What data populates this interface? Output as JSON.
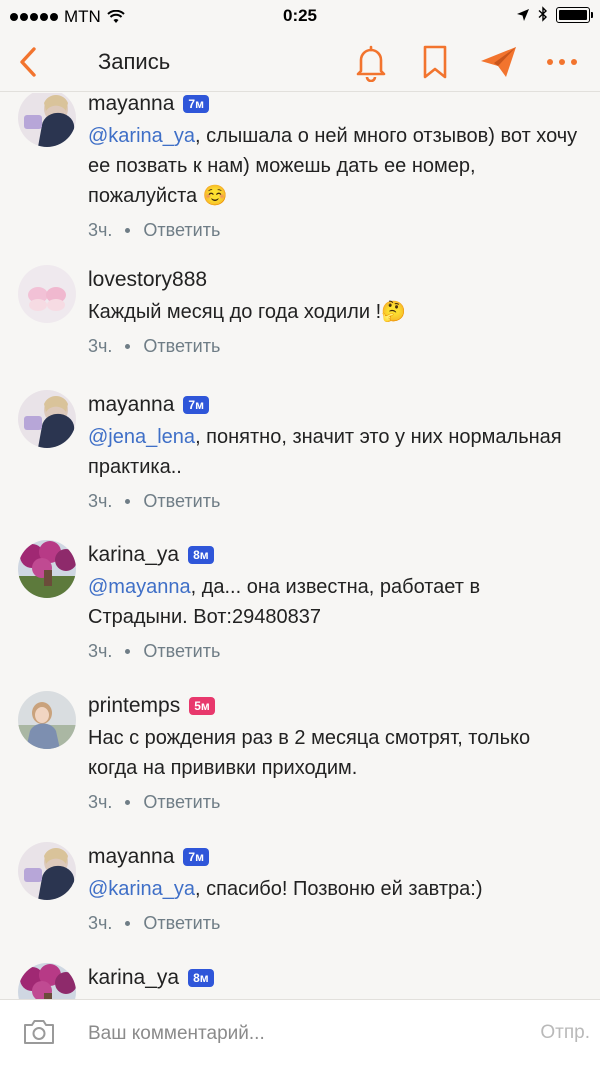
{
  "status_bar": {
    "carrier": "MTN",
    "time": "0:25"
  },
  "nav": {
    "title": "Запись",
    "icons": [
      "back-icon",
      "bell-icon",
      "bookmark-icon",
      "send-icon",
      "more-icon"
    ],
    "accent_color": "#f2742e"
  },
  "comments": [
    {
      "username": "mayanna",
      "badge": "7м",
      "badge_color": "#2f56d9",
      "mention": "@karina_ya",
      "text": ", слышала о ней много отзывов) вот хочу ее позвать к нам) можешь дать ее номер, пожалуйста ☺️",
      "time": "3ч.",
      "reply_label": "Ответить"
    },
    {
      "username": "lovestory888",
      "badge": "",
      "mention": "",
      "text": "Каждый месяц до года ходили !🤔",
      "time": "3ч.",
      "reply_label": "Ответить"
    },
    {
      "username": "mayanna",
      "badge": "7м",
      "badge_color": "#2f56d9",
      "mention": "@jena_lena",
      "text": ", понятно, значит это у них нормальная практика..",
      "time": "3ч.",
      "reply_label": "Ответить"
    },
    {
      "username": "karina_ya",
      "badge": "8м",
      "badge_color": "#2f56d9",
      "mention": "@mayanna",
      "text": ", да... она известна, работает в Страдыни. Вот:29480837",
      "time": "3ч.",
      "reply_label": "Ответить"
    },
    {
      "username": "printemps",
      "badge": "5м",
      "badge_color": "#e8386c",
      "mention": "",
      "text": "Нас с рождения раз в 2 месяца смотрят, только когда на прививки приходим.",
      "time": "3ч.",
      "reply_label": "Ответить"
    },
    {
      "username": "mayanna",
      "badge": "7м",
      "badge_color": "#2f56d9",
      "mention": "@karina_ya",
      "text": ", спасибо! Позвоню ей завтра:)",
      "time": "3ч.",
      "reply_label": "Ответить"
    },
    {
      "username": "karina_ya",
      "badge": "8м",
      "badge_color": "#2f56d9",
      "mention": "",
      "text": "",
      "time": "",
      "reply_label": ""
    }
  ],
  "composer": {
    "placeholder": "Ваш комментарий...",
    "value": "",
    "send_label": "Отпр."
  }
}
